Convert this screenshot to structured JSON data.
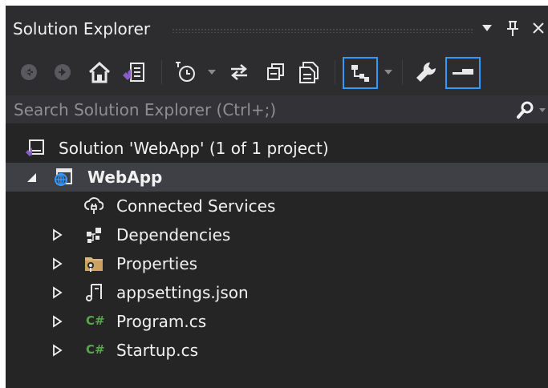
{
  "window": {
    "title": "Solution Explorer"
  },
  "toolbar": {
    "buttons": [
      {
        "name": "back-button",
        "icon": "arrow-left-circle-icon"
      },
      {
        "name": "forward-button",
        "icon": "arrow-right-circle-icon"
      },
      {
        "name": "home-button",
        "icon": "home-icon"
      },
      {
        "name": "switch-views-button",
        "icon": "vs-document-icon"
      },
      {
        "name": "pending-changes-filter-button",
        "icon": "history-clock-icon"
      },
      {
        "name": "sync-with-active-document-button",
        "icon": "sync-arrows-icon"
      },
      {
        "name": "collapse-all-button",
        "icon": "collapse-all-icon"
      },
      {
        "name": "show-all-files-button",
        "icon": "show-all-files-icon"
      },
      {
        "name": "filter-button",
        "icon": "hierarchy-filter-icon",
        "selected": true
      },
      {
        "name": "properties-button",
        "icon": "wrench-icon"
      },
      {
        "name": "preview-selected-items-button",
        "icon": "preview-tab-icon",
        "selected": true
      }
    ]
  },
  "search": {
    "placeholder": "Search Solution Explorer (Ctrl+;)",
    "value": ""
  },
  "tree": {
    "solution": {
      "label": "Solution 'WebApp' (1 of 1 project)",
      "icon": "solution-icon"
    },
    "project": {
      "label": "WebApp",
      "icon": "web-project-icon",
      "expanded": true,
      "selected": true
    },
    "items": [
      {
        "label": "Connected Services",
        "icon": "connected-services-icon",
        "expandable": false
      },
      {
        "label": "Dependencies",
        "icon": "dependencies-icon",
        "expandable": true
      },
      {
        "label": "Properties",
        "icon": "properties-folder-icon",
        "expandable": true
      },
      {
        "label": "appsettings.json",
        "icon": "json-file-icon",
        "expandable": true
      },
      {
        "label": "Program.cs",
        "icon": "csharp-file-icon",
        "icon_text": "C#",
        "expandable": true
      },
      {
        "label": "Startup.cs",
        "icon": "csharp-file-icon",
        "icon_text": "C#",
        "expandable": true
      }
    ]
  },
  "colors": {
    "background": "#252526",
    "toolbar": "#2d2d30",
    "selection": "#3f3f46",
    "accent_blue": "#3399ff",
    "vs_purple": "#865fc5",
    "csharp_green": "#57a64a"
  }
}
